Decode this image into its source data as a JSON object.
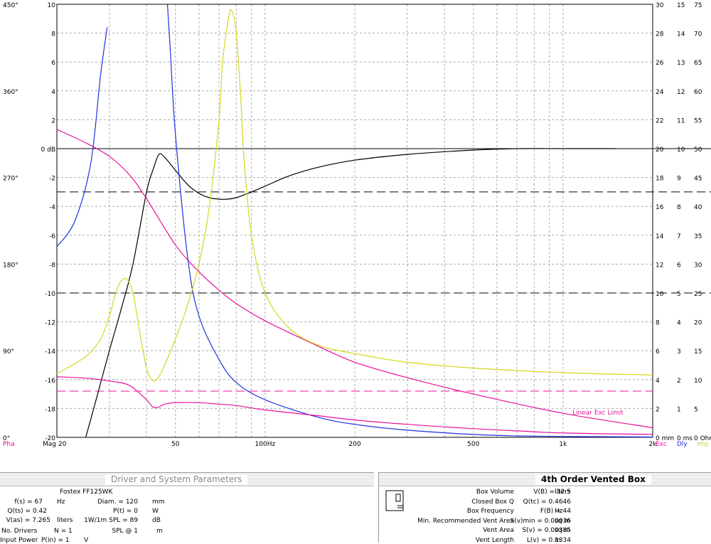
{
  "chart_data": {
    "type": "line",
    "x_scale": "log",
    "xlim": [
      20,
      2000
    ],
    "x_ticks": [
      "20",
      "50",
      "100Hz",
      "200",
      "500",
      "1k",
      "2k"
    ],
    "grid": true,
    "left_axis_db": {
      "ticks": [
        "10",
        "8",
        "6",
        "4",
        "2",
        "0 dB",
        "-2",
        "-4",
        "-6",
        "-8",
        "-10",
        "-12",
        "-14",
        "-16",
        "-18",
        "-20"
      ],
      "ylim": [
        -20,
        10
      ]
    },
    "phase_axis": {
      "ticks": [
        "450°",
        "360°",
        "270°",
        "180°",
        "90°",
        "0°"
      ],
      "ylim": [
        0,
        450
      ]
    },
    "right_axes": [
      {
        "label": "Exc",
        "ticks": [
          "30",
          "28",
          "26",
          "24",
          "22",
          "20",
          "18",
          "16",
          "14",
          "12",
          "10",
          "8",
          "6",
          "4",
          "2",
          "0 mm"
        ]
      },
      {
        "label": "Dly",
        "ticks": [
          "15",
          "14",
          "13",
          "12",
          "11",
          "10",
          "9",
          "8",
          "7",
          "6",
          "5",
          "4",
          "3",
          "2",
          "1",
          "0 ms"
        ]
      },
      {
        "label": "Imp",
        "ticks": [
          "75",
          "70",
          "65",
          "60",
          "55",
          "50",
          "45",
          "40",
          "35",
          "30",
          "25",
          "20",
          "15",
          "10",
          "5",
          "0 Ohm"
        ]
      }
    ],
    "bottom_labels": {
      "left1": "Pha",
      "left2": "Mag",
      "r1": "Exc",
      "r2": "Dly",
      "r3": "Imp"
    },
    "annotation": "Linear Exc Limit",
    "colors": {
      "magnitude": "#000000",
      "phase": "#e8109a",
      "excursion": "#e8109a",
      "delay": "#2030e0",
      "impedance": "#d6d61e"
    },
    "reference_lines": [
      {
        "axis": "db",
        "value": 0,
        "style": "solid"
      },
      {
        "axis": "db",
        "value": -3,
        "style": "dashed"
      },
      {
        "axis": "db",
        "value": -10,
        "style": "dashed"
      },
      {
        "axis": "mm",
        "value": 3.2,
        "style": "dashed",
        "color": "#e8109a"
      }
    ],
    "series": [
      {
        "key": "magnitude",
        "x": [
          25,
          27,
          30,
          33,
          36,
          40,
          42,
          44,
          46,
          50,
          55,
          60,
          65,
          70,
          75,
          80,
          85,
          90,
          100,
          120,
          150,
          200,
          300,
          500,
          700,
          1000,
          1500
        ],
        "y": [
          -20,
          -17.5,
          -14,
          -11,
          -8,
          -3,
          -1.5,
          -0.4,
          -0.6,
          -1.5,
          -2.5,
          -3.1,
          -3.4,
          -3.5,
          -3.5,
          -3.4,
          -3.2,
          -3,
          -2.6,
          -1.9,
          -1.3,
          -0.8,
          -0.4,
          -0.1,
          0,
          0,
          0
        ]
      },
      {
        "key": "phase",
        "x": [
          20,
          25,
          30,
          35,
          40,
          50,
          60,
          70,
          80,
          100,
          150,
          200,
          300,
          500,
          1000,
          2000
        ],
        "y": [
          320,
          306,
          292,
          273,
          248,
          200,
          172,
          153,
          139,
          121,
          95,
          78,
          62,
          45,
          25,
          10
        ]
      },
      {
        "key": "delay",
        "x": [
          20,
          23,
          26,
          28,
          29.5
        ],
        "y": [
          6.6,
          7.5,
          9.5,
          12.5,
          14.2
        ]
      },
      {
        "key": "delay2",
        "x": [
          47,
          48,
          50,
          55,
          60,
          70,
          80,
          100,
          150,
          200,
          300,
          500,
          700,
          1000,
          1500,
          2000
        ],
        "y": [
          15,
          13.5,
          10.5,
          6.2,
          4.2,
          2.7,
          1.9,
          1.3,
          0.7,
          0.45,
          0.25,
          0.1,
          0.05,
          0.03,
          0.02,
          0.01
        ]
      },
      {
        "key": "excursion",
        "x": [
          20,
          25,
          30,
          35,
          40,
          42,
          44,
          46,
          50,
          60,
          70,
          80,
          100,
          150,
          200,
          300,
          500,
          700,
          1000,
          2000
        ],
        "y": [
          4.2,
          4.1,
          3.9,
          3.6,
          2.6,
          2.1,
          2.1,
          2.3,
          2.4,
          2.4,
          2.3,
          2.2,
          1.9,
          1.5,
          1.2,
          0.9,
          0.6,
          0.45,
          0.3,
          0.2
        ]
      },
      {
        "key": "impedance",
        "x": [
          20,
          25,
          28,
          30,
          32,
          34,
          36,
          38,
          40,
          42,
          44,
          46,
          50,
          55,
          60,
          65,
          70,
          72,
          75,
          77,
          80,
          83,
          85,
          90,
          100,
          120,
          150,
          200,
          300,
          500,
          1000,
          2000
        ],
        "y": [
          11,
          14,
          17,
          21,
          26,
          27.5,
          25,
          18,
          12,
          9.8,
          10.5,
          12.5,
          17,
          23,
          30,
          40,
          55,
          65,
          72,
          74,
          70,
          58,
          48,
          35,
          25,
          19,
          16,
          14.5,
          13,
          12,
          11.2,
          10.8
        ]
      }
    ]
  },
  "left_panel": {
    "title": "Driver and System Parameters",
    "driver": "Fostex FF125WK",
    "row1": {
      "n1": "f(s) = 67",
      "u1": "Hz",
      "n2": "Diam. = 120",
      "u2": "mm"
    },
    "row2": {
      "n1": "Q(ts) = 0.42",
      "u1": "",
      "n2": "P(t) = 0",
      "u2": "W"
    },
    "row3": {
      "n1": "V(as) = 7.265",
      "u1": "liters",
      "n2": "1W/1m SPL = 89",
      "u2": "dB"
    },
    "row4": {
      "n1": "No. Drivers",
      "n1b": "N = 1",
      "n2": "SPL @ 1",
      "u2": "m"
    },
    "row5": {
      "n1": "Input Power",
      "n1b": "P(in) = 1",
      "u1": "V"
    }
  },
  "right_panel": {
    "title": "4th Order Vented Box",
    "rows": [
      {
        "label": "Box Volume",
        "value": "V(B) = 32.5",
        "unit": "liters"
      },
      {
        "label": "Closed Box Q",
        "value": "Q(tc) = 0.4646",
        "unit": ""
      },
      {
        "label": "Box Frequency",
        "value": "F(B) = 44",
        "unit": "Hz"
      },
      {
        "label": "Min. Recommended Vent Area",
        "value": "S(v)min = 0.00036",
        "unit": "sq m"
      },
      {
        "label": "Vent Area",
        "value": "S(v) = 0.00385",
        "unit": "sq m"
      },
      {
        "label": "Vent Length",
        "value": "L(v) = 0.1334",
        "unit": "m"
      }
    ]
  }
}
